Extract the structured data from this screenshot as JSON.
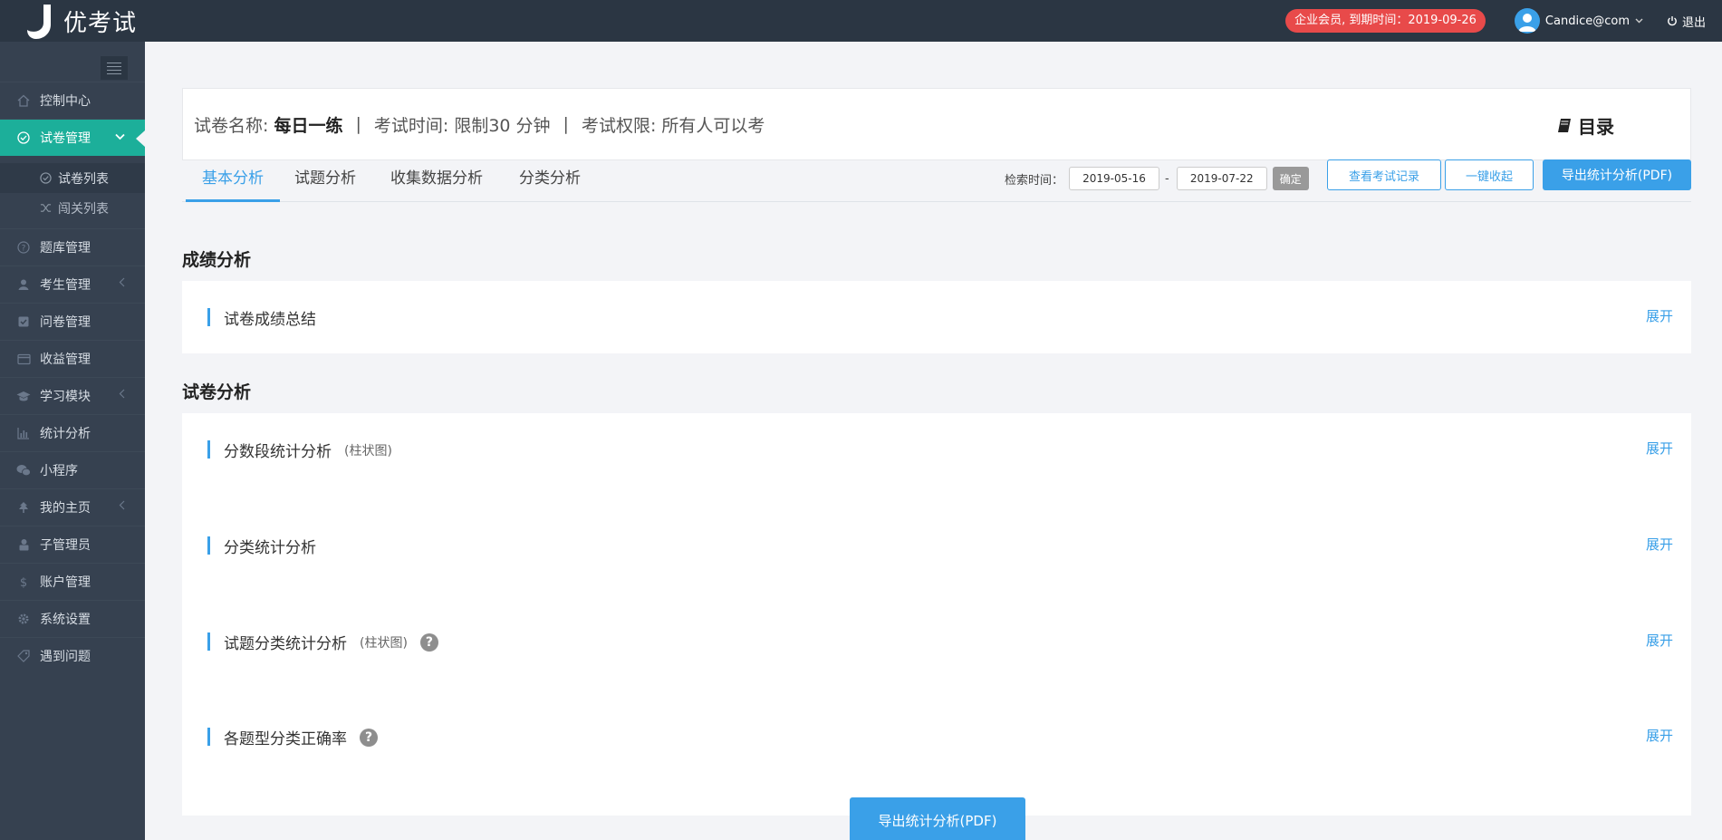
{
  "app": {
    "logo_text": "优考试"
  },
  "topbar": {
    "member_badge": "企业会员, 到期时间：2019-09-26",
    "user_name": "Candice@com",
    "logout_label": "退出"
  },
  "sidebar": {
    "items": [
      {
        "label": "控制中心",
        "icon": "home-icon"
      },
      {
        "label": "试卷管理",
        "icon": "check-circle-icon",
        "active": true
      },
      {
        "label": "题库管理",
        "icon": "question-circle-icon"
      },
      {
        "label": "考生管理",
        "icon": "user-icon"
      },
      {
        "label": "问卷管理",
        "icon": "checkbox-icon"
      },
      {
        "label": "收益管理",
        "icon": "credit-card-icon"
      },
      {
        "label": "学习模块",
        "icon": "graduation-cap-icon"
      },
      {
        "label": "统计分析",
        "icon": "bar-chart-icon"
      },
      {
        "label": "小程序",
        "icon": "wechat-icon"
      },
      {
        "label": "我的主页",
        "icon": "tree-icon"
      },
      {
        "label": "子管理员",
        "icon": "lock-user-icon"
      },
      {
        "label": "账户管理",
        "icon": "dollar-icon"
      },
      {
        "label": "系统设置",
        "icon": "gear-icon"
      },
      {
        "label": "遇到问题",
        "icon": "tag-icon"
      }
    ],
    "subitems": [
      {
        "label": "试卷列表",
        "icon": "check-circle-icon"
      },
      {
        "label": "闯关列表",
        "icon": "shuffle-icon"
      }
    ]
  },
  "header": {
    "name_label": "试卷名称:",
    "name_value": "每日一练",
    "sep": "|",
    "time_label": "考试时间:",
    "time_value": "限制30 分钟",
    "perm_label": "考试权限:",
    "perm_value": "所有人可以考",
    "toc_label": "目录"
  },
  "tabs": [
    "基本分析",
    "试题分析",
    "收集数据分析",
    "分类分析"
  ],
  "filter": {
    "label": "检索时间：",
    "start_date": "2019-05-16",
    "dash": "-",
    "end_date": "2019-07-22",
    "confirm": "确定"
  },
  "actions": {
    "view_records": "查看考试记录",
    "collapse_all": "一键收起",
    "export_pdf": "导出统计分析(PDF)"
  },
  "sections": {
    "score": {
      "title": "成绩分析",
      "rows": [
        {
          "title": "试卷成绩总结",
          "expand": "展开"
        }
      ]
    },
    "paper": {
      "title": "试卷分析",
      "rows": [
        {
          "title": "分数段统计分析",
          "note": "(柱状图)",
          "expand": "展开"
        },
        {
          "title": "分类统计分析",
          "expand": "展开"
        },
        {
          "title": "试题分类统计分析",
          "note": "(柱状图)",
          "help": "?",
          "expand": "展开"
        },
        {
          "title": "各题型分类正确率",
          "help": "?",
          "expand": "展开"
        }
      ]
    }
  },
  "bottom": {
    "export_pdf": "导出统计分析(PDF)"
  },
  "colors": {
    "topbar": "#2b3643",
    "sidebar": "#364150",
    "active": "#1caf9a",
    "accent": "#3aa0e8",
    "badge": "#e84a4a"
  }
}
